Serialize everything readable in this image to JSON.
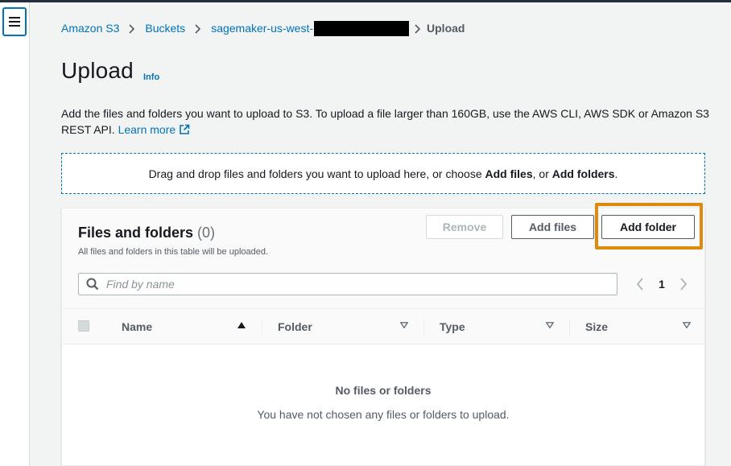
{
  "breadcrumb": {
    "items": [
      "Amazon S3",
      "Buckets",
      "sagemaker-us-west-"
    ],
    "current": "Upload"
  },
  "page": {
    "title": "Upload",
    "info_label": "Info",
    "description": "Add the files and folders you want to upload to S3. To upload a file larger than 160GB, use the AWS CLI, AWS SDK or Amazon S3 REST API.",
    "learn_more": "Learn more"
  },
  "dropzone": {
    "prefix": "Drag and drop files and folders you want to upload here, or choose ",
    "add_files": "Add files",
    "middle": ", or ",
    "add_folders": "Add folders",
    "suffix": "."
  },
  "panel": {
    "title": "Files and folders",
    "count": "(0)",
    "subtitle": "All files and folders in this table will be uploaded.",
    "buttons": {
      "remove": "Remove",
      "add_files": "Add files",
      "add_folder": "Add folder"
    },
    "search_placeholder": "Find by name",
    "page_number": "1",
    "columns": [
      "Name",
      "Folder",
      "Type",
      "Size"
    ],
    "empty_title": "No files or folders",
    "empty_description": "You have not chosen any files or folders to upload."
  },
  "icons": {
    "menu": "hamburger-icon",
    "breadcrumb_separator": "chevron-right-icon",
    "external_link": "external-link-icon",
    "search": "search-icon",
    "prev": "chevron-left-icon",
    "next": "chevron-right-icon",
    "sort_asc": "caret-up-icon",
    "sort_desc": "caret-down-icon"
  },
  "colors": {
    "link": "#0073bb",
    "highlight": "#e08a0b",
    "header": "#232f3e"
  }
}
